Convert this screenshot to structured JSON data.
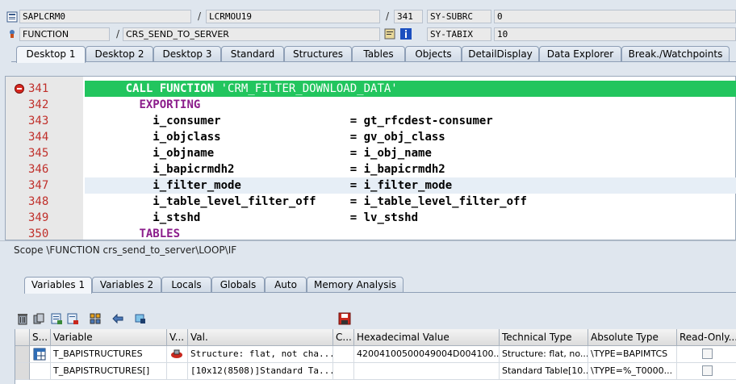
{
  "header": {
    "program": "SAPLCRM0",
    "include": "LCRMOU19",
    "line": "341",
    "sy_subrc_label": "SY-SUBRC",
    "sy_subrc_value": "0",
    "event_type": "FUNCTION",
    "event": "CRS_SEND_TO_SERVER",
    "sy_tabix_label": "SY-TABIX",
    "sy_tabix_value": "10",
    "sep1": "/",
    "sep2": "/",
    "sep3": "/"
  },
  "top_tabs": [
    "Desktop 1",
    "Desktop 2",
    "Desktop 3",
    "Standard",
    "Structures",
    "Tables",
    "Objects",
    "DetailDisplay",
    "Data Explorer",
    "Break./Watchpoints"
  ],
  "code_lines": [
    {
      "num": "341",
      "indent": "      ",
      "kw": "CALL FUNCTION",
      "rest": " ",
      "str": "'CRM_FILTER_DOWNLOAD_DATA'",
      "tail": ""
    },
    {
      "num": "342",
      "indent": "        ",
      "kw": "EXPORTING",
      "rest": "",
      "str": "",
      "tail": ""
    },
    {
      "num": "343",
      "indent": "          ",
      "kw": "",
      "rest": "i_consumer                   = gt_rfcdest-consumer",
      "str": "",
      "tail": ""
    },
    {
      "num": "344",
      "indent": "          ",
      "kw": "",
      "rest": "i_objclass                   = gv_obj_class",
      "str": "",
      "tail": ""
    },
    {
      "num": "345",
      "indent": "          ",
      "kw": "",
      "rest": "i_objname                    = i_obj_name",
      "str": "",
      "tail": ""
    },
    {
      "num": "346",
      "indent": "          ",
      "kw": "",
      "rest": "i_bapicrmdh2                 = i_bapicrmdh2",
      "str": "",
      "tail": ""
    },
    {
      "num": "347",
      "indent": "          ",
      "kw": "",
      "rest": "i_filter_mode                = i_filter_mode",
      "str": "",
      "tail": ""
    },
    {
      "num": "348",
      "indent": "          ",
      "kw": "",
      "rest": "i_table_level_filter_off     = i_table_level_filter_off",
      "str": "",
      "tail": ""
    },
    {
      "num": "349",
      "indent": "          ",
      "kw": "",
      "rest": "i_stshd                      = lv_stshd",
      "str": "",
      "tail": ""
    },
    {
      "num": "350",
      "indent": "        ",
      "kw": "TABLES",
      "rest": "",
      "str": "",
      "tail": ""
    }
  ],
  "scope": "Scope \\FUNCTION crs_send_to_server\\LOOP\\IF",
  "lower_tabs": [
    "Variables 1",
    "Variables 2",
    "Locals",
    "Globals",
    "Auto",
    "Memory Analysis"
  ],
  "table": {
    "columns": [
      "S...",
      "Variable",
      "V...",
      "Val.",
      "C...",
      "Hexadecimal Value",
      "Technical Type",
      "Absolute Type",
      "Read-Only..."
    ],
    "rows": [
      {
        "variable": "T_BAPISTRUCTURES",
        "val": "Structure: flat, not cha...",
        "hex": "42004100500049004D004100...",
        "tech": "Structure: flat, no...",
        "abs": "\\TYPE=BAPIMTCS"
      },
      {
        "variable": "T_BAPISTRUCTURES[]",
        "val": "[10x12(8508)]Standard Ta...",
        "hex": "",
        "tech": "Standard Table[10...",
        "abs": "\\TYPE=%_T0000..."
      }
    ]
  }
}
